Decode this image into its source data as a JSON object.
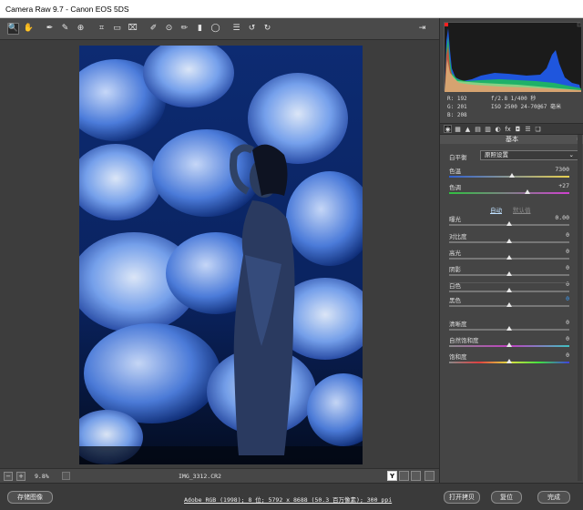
{
  "window": {
    "title": "Camera Raw 9.7 -  Canon EOS 5DS"
  },
  "toolbar": {
    "tools": [
      {
        "name": "zoom-tool",
        "glyph": "🔍",
        "active": true
      },
      {
        "name": "hand-tool",
        "glyph": "✋"
      },
      {
        "name": "white-balance-tool",
        "glyph": "✒"
      },
      {
        "name": "color-sampler-tool",
        "glyph": "✎"
      },
      {
        "name": "target-adjust-tool",
        "glyph": "⊕"
      },
      {
        "name": "crop-tool",
        "glyph": "⌗"
      },
      {
        "name": "straighten-tool",
        "glyph": "▭"
      },
      {
        "name": "transform-tool",
        "glyph": "⌧"
      },
      {
        "name": "spot-removal-tool",
        "glyph": "✐"
      },
      {
        "name": "red-eye-tool",
        "glyph": "⊙"
      },
      {
        "name": "adjustment-brush-tool",
        "glyph": "✏"
      },
      {
        "name": "graduated-filter-tool",
        "glyph": "▮"
      },
      {
        "name": "radial-filter-tool",
        "glyph": "◯"
      },
      {
        "name": "preferences-tool",
        "glyph": "☰"
      },
      {
        "name": "rotate-ccw-tool",
        "glyph": "↺"
      },
      {
        "name": "rotate-cw-tool",
        "glyph": "↻"
      }
    ],
    "fullscreen_glyph": "⇥"
  },
  "status": {
    "zoom_out": "−",
    "zoom_in": "+",
    "zoom": "9.8%",
    "filename": "IMG_3312.CR2",
    "y_button": "Y"
  },
  "footer": {
    "save_label": "存储图像",
    "workflow_link": "Adobe RGB (1998); 8 位; 5792 x 8688 (50.3 百万像素); 300 ppi",
    "open_copy_label": "打开拷贝",
    "reset_label": "复位",
    "done_label": "完成"
  },
  "readout": {
    "r": "R:  192",
    "g": "G:  201",
    "b": "B:  208",
    "exif_1": "f/2.8  1/400 秒",
    "exif_2": "ISO 2500  24-70@67 毫米"
  },
  "panel": {
    "section": "基本",
    "wb_label": "白平衡",
    "wb_value": "原照设置",
    "auto_label": "自动",
    "default_label": "默认值",
    "sliders": [
      {
        "key": "temp",
        "label": "色温",
        "value": "7300",
        "fraction": 0.52,
        "track": "linear-gradient(90deg,#3060d0,#e8d050)"
      },
      {
        "key": "tint",
        "label": "色调",
        "value": "+27",
        "fraction": 0.65,
        "track": "linear-gradient(90deg,#30c040,#d040d0)"
      },
      {
        "key": "exposure",
        "label": "曝光",
        "value": "0.00",
        "fraction": 0.5
      },
      {
        "key": "contrast",
        "label": "对比度",
        "value": "0",
        "fraction": 0.5
      },
      {
        "key": "highlights",
        "label": "高光",
        "value": "0",
        "fraction": 0.5
      },
      {
        "key": "shadows",
        "label": "阴影",
        "value": "0",
        "fraction": 0.5
      },
      {
        "key": "whites",
        "label": "白色",
        "value": "0",
        "fraction": 0.5
      },
      {
        "key": "blacks",
        "label": "黑色",
        "value": "0",
        "fraction": 0.5,
        "highlight": true
      },
      {
        "key": "clarity",
        "label": "清晰度",
        "value": "0",
        "fraction": 0.5
      },
      {
        "key": "vibrance",
        "label": "自然饱和度",
        "value": "0",
        "fraction": 0.5,
        "track": "linear-gradient(90deg,#888,#c040c0,#40c0c0)"
      },
      {
        "key": "saturation",
        "label": "饱和度",
        "value": "0",
        "fraction": 0.5,
        "track": "linear-gradient(90deg,#888,#e04040,#e0e040,#40e040,#4040e0)"
      }
    ],
    "tabs": [
      "◉",
      "▦",
      "▲",
      "▤",
      "▥",
      "◐",
      "fx",
      "◘",
      "☰",
      "❏"
    ]
  },
  "colors": {
    "photo_bg": "#06142e",
    "flower_light": "#bcd6ff",
    "flower_mid": "#3f78e8",
    "flower_dark": "#0b2a78"
  }
}
